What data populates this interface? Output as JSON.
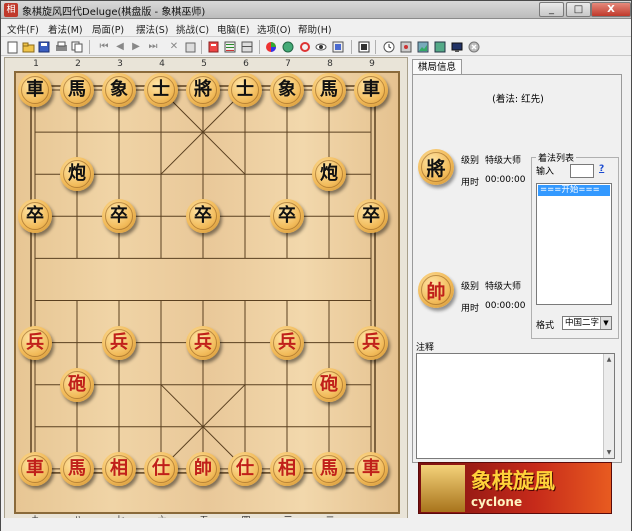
{
  "window": {
    "title": "象棋旋风四代Deluge(棋盘版 - 象棋巫师)",
    "buttons": {
      "minimize": "_",
      "maximize": "□",
      "close": "X"
    }
  },
  "menu": [
    {
      "label": "文件(F)"
    },
    {
      "label": "着法(M)"
    },
    {
      "label": "局面(P)"
    },
    {
      "label": "摆法(S)"
    },
    {
      "label": "挑战(C)"
    },
    {
      "label": "电脑(E)"
    },
    {
      "label": "选项(O)"
    },
    {
      "label": "帮助(H)"
    }
  ],
  "board": {
    "top_numbers": [
      "1",
      "2",
      "3",
      "4",
      "5",
      "6",
      "7",
      "8",
      "9"
    ],
    "bottom_numbers": [
      "九",
      "八",
      "七",
      "六",
      "五",
      "四",
      "三",
      "二",
      "一"
    ],
    "pieces": [
      {
        "c": "black",
        "t": "車",
        "col": 0,
        "row": 0
      },
      {
        "c": "black",
        "t": "馬",
        "col": 1,
        "row": 0
      },
      {
        "c": "black",
        "t": "象",
        "col": 2,
        "row": 0
      },
      {
        "c": "black",
        "t": "士",
        "col": 3,
        "row": 0
      },
      {
        "c": "black",
        "t": "將",
        "col": 4,
        "row": 0
      },
      {
        "c": "black",
        "t": "士",
        "col": 5,
        "row": 0
      },
      {
        "c": "black",
        "t": "象",
        "col": 6,
        "row": 0
      },
      {
        "c": "black",
        "t": "馬",
        "col": 7,
        "row": 0
      },
      {
        "c": "black",
        "t": "車",
        "col": 8,
        "row": 0
      },
      {
        "c": "black",
        "t": "炮",
        "col": 1,
        "row": 2
      },
      {
        "c": "black",
        "t": "炮",
        "col": 7,
        "row": 2
      },
      {
        "c": "black",
        "t": "卒",
        "col": 0,
        "row": 3
      },
      {
        "c": "black",
        "t": "卒",
        "col": 2,
        "row": 3
      },
      {
        "c": "black",
        "t": "卒",
        "col": 4,
        "row": 3
      },
      {
        "c": "black",
        "t": "卒",
        "col": 6,
        "row": 3
      },
      {
        "c": "black",
        "t": "卒",
        "col": 8,
        "row": 3
      },
      {
        "c": "red",
        "t": "兵",
        "col": 0,
        "row": 6
      },
      {
        "c": "red",
        "t": "兵",
        "col": 2,
        "row": 6
      },
      {
        "c": "red",
        "t": "兵",
        "col": 4,
        "row": 6
      },
      {
        "c": "red",
        "t": "兵",
        "col": 6,
        "row": 6
      },
      {
        "c": "red",
        "t": "兵",
        "col": 8,
        "row": 6
      },
      {
        "c": "red",
        "t": "砲",
        "col": 1,
        "row": 7
      },
      {
        "c": "red",
        "t": "砲",
        "col": 7,
        "row": 7
      },
      {
        "c": "red",
        "t": "車",
        "col": 0,
        "row": 9
      },
      {
        "c": "red",
        "t": "馬",
        "col": 1,
        "row": 9
      },
      {
        "c": "red",
        "t": "相",
        "col": 2,
        "row": 9
      },
      {
        "c": "red",
        "t": "仕",
        "col": 3,
        "row": 9
      },
      {
        "c": "red",
        "t": "帥",
        "col": 4,
        "row": 9
      },
      {
        "c": "red",
        "t": "仕",
        "col": 5,
        "row": 9
      },
      {
        "c": "red",
        "t": "相",
        "col": 6,
        "row": 9
      },
      {
        "c": "red",
        "t": "馬",
        "col": 7,
        "row": 9
      },
      {
        "c": "red",
        "t": "車",
        "col": 8,
        "row": 9
      }
    ]
  },
  "panel": {
    "tab_label": "棋局信息",
    "to_move": "(着法: 红先)",
    "black_player": {
      "piece": "將",
      "level_label": "级别",
      "level": "特级大师",
      "time_label": "用时",
      "time": "00:00:00"
    },
    "red_player": {
      "piece": "帥",
      "level_label": "级别",
      "level": "特级大师",
      "time_label": "用时",
      "time": "00:00:00"
    },
    "movelist_title": "着法列表",
    "input_label": "输入",
    "help_glyph": "?",
    "movelist_selected": "===开始===",
    "format_label": "格式",
    "format_value": "中国二字",
    "notes_label": "注释"
  },
  "banner": {
    "title": "象棋旋風",
    "subtitle": "cyclone"
  },
  "colors": {
    "red_piece_text": "#c0201a",
    "board_line": "#5a4020",
    "banner_bg": "#c62a1a"
  }
}
